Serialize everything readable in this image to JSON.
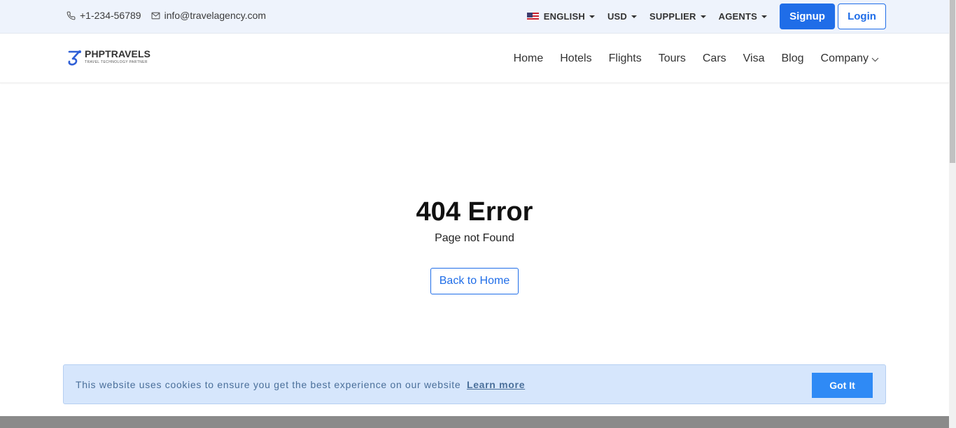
{
  "topbar": {
    "phone": "+1-234-56789",
    "email": "info@travelagency.com",
    "language": "ENGLISH",
    "currency": "USD",
    "supplier": "SUPPLIER",
    "agents": "AGENTS",
    "signup_label": "Signup",
    "login_label": "Login"
  },
  "navbar": {
    "logo_main": "PHPTRAVELS",
    "logo_sub": "TRAVEL TECHNOLOGY PARTNER",
    "links": [
      "Home",
      "Hotels",
      "Flights",
      "Tours",
      "Cars",
      "Visa",
      "Blog",
      "Company"
    ]
  },
  "error": {
    "title": "404 Error",
    "subtitle": "Page not Found",
    "back_label": "Back to Home"
  },
  "cookie": {
    "text": "This website uses cookies to ensure you get the best experience on our website",
    "link": "Learn more",
    "button": "Got It"
  },
  "colors": {
    "primary": "#1f6de8",
    "topbar_bg": "#eef3fc",
    "cookie_bg": "#d6e6fc",
    "cookie_button": "#2f8af5"
  },
  "icons": {
    "phone": "phone-icon",
    "email": "mail-icon",
    "flag": "us-flag-icon",
    "company_dropdown": "chevron-down-icon"
  }
}
